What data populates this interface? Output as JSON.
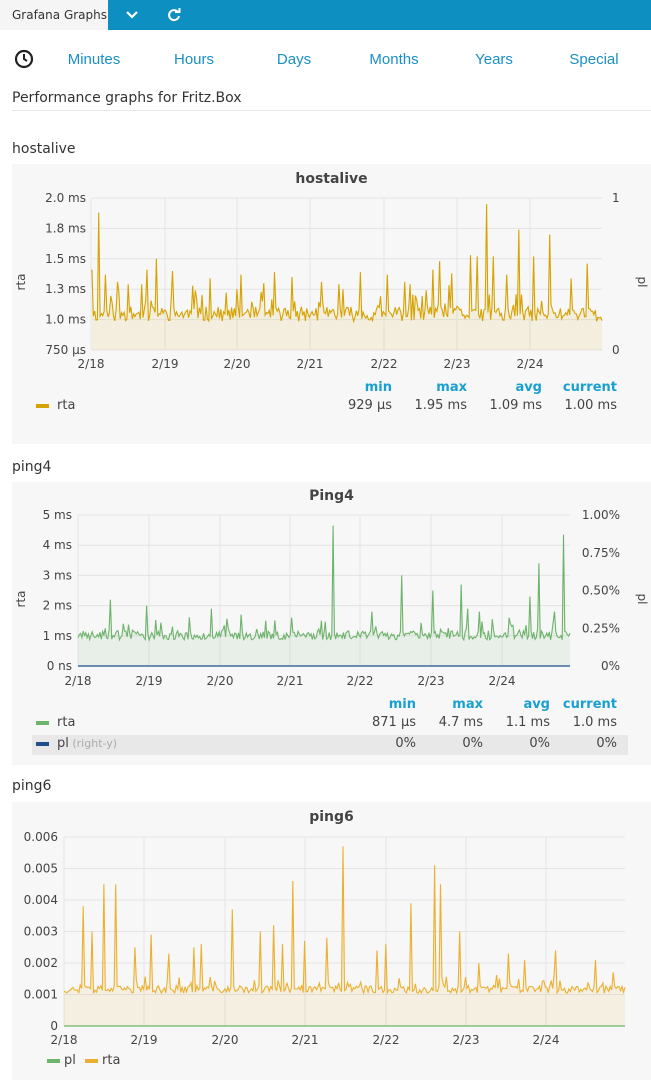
{
  "app": {
    "brand": "Grafana Graphs"
  },
  "tabs": [
    "Minutes",
    "Hours",
    "Days",
    "Months",
    "Years",
    "Special"
  ],
  "page": {
    "title": "Performance graphs for Fritz.Box"
  },
  "sections": [
    {
      "name": "hostalive",
      "panel_title": "hostalive"
    },
    {
      "name": "ping4",
      "panel_title": "Ping4"
    },
    {
      "name": "ping6",
      "panel_title": "ping6"
    }
  ],
  "legend_headers": {
    "min": "min",
    "max": "max",
    "avg": "avg",
    "current": "current"
  },
  "legends": {
    "hostalive": [
      {
        "name": "rta",
        "color": "#d6a200",
        "min": "929 µs",
        "max": "1.95 ms",
        "avg": "1.09 ms",
        "current": "1.00 ms"
      }
    ],
    "ping4": [
      {
        "name": "rta",
        "color": "#6db36a",
        "min": "871 µs",
        "max": "4.7 ms",
        "avg": "1.1 ms",
        "current": "1.0 ms"
      },
      {
        "name": "pl",
        "suffix": "(right-y)",
        "color": "#1f4e8c",
        "min": "0%",
        "max": "0%",
        "avg": "0%",
        "current": "0%"
      }
    ],
    "ping6": [
      {
        "name": "pl",
        "color": "#6db36a"
      },
      {
        "name": "rta",
        "color": "#ebb02f"
      }
    ]
  },
  "chart_data": [
    {
      "type": "line",
      "title": "hostalive",
      "ylabel": "rta",
      "ylabel_right": "pl",
      "x_ticks": [
        "2/18",
        "2/19",
        "2/20",
        "2/21",
        "2/22",
        "2/23",
        "2/24"
      ],
      "y_ticks": [
        "750 µs",
        "1.0 ms",
        "1.3 ms",
        "1.5 ms",
        "1.8 ms",
        "2.0 ms"
      ],
      "y_ticks_right": [
        "0",
        "1"
      ],
      "ylim": [
        0.75,
        2.0
      ],
      "series": [
        {
          "name": "rta",
          "color": "#d6a200",
          "baseline": 1.04,
          "noise": 0.06,
          "seed": 11,
          "spikes": [
            [
              0.0,
              1.41
            ],
            [
              0.1,
              1.88
            ],
            [
              0.19,
              1.37
            ],
            [
              0.35,
              1.31
            ],
            [
              0.5,
              1.29
            ],
            [
              0.68,
              1.29
            ],
            [
              0.76,
              1.41
            ],
            [
              0.88,
              1.5
            ],
            [
              1.1,
              1.4
            ],
            [
              1.38,
              1.28
            ],
            [
              1.63,
              1.34
            ],
            [
              2.05,
              1.37
            ],
            [
              2.36,
              1.3
            ],
            [
              2.51,
              1.39
            ],
            [
              2.75,
              1.35
            ],
            [
              3.15,
              1.31
            ],
            [
              3.39,
              1.29
            ],
            [
              3.69,
              1.39
            ],
            [
              4.06,
              1.37
            ],
            [
              4.3,
              1.31
            ],
            [
              4.68,
              1.41
            ],
            [
              4.78,
              1.48
            ],
            [
              4.93,
              1.38
            ],
            [
              5.2,
              1.53
            ],
            [
              5.29,
              1.52
            ],
            [
              5.42,
              1.95
            ],
            [
              5.51,
              1.52
            ],
            [
              5.7,
              1.37
            ],
            [
              5.86,
              1.74
            ],
            [
              6.06,
              1.52
            ],
            [
              6.28,
              1.7
            ],
            [
              6.57,
              1.34
            ],
            [
              6.79,
              1.46
            ],
            [
              7.01,
              1.42
            ],
            [
              7.19,
              1.29
            ]
          ]
        }
      ]
    },
    {
      "type": "line",
      "title": "Ping4",
      "ylabel": "rta",
      "ylabel_right": "pl",
      "x_ticks": [
        "2/18",
        "2/19",
        "2/20",
        "2/21",
        "2/22",
        "2/23",
        "2/24"
      ],
      "y_ticks": [
        "0 ns",
        "1 ms",
        "2 ms",
        "3 ms",
        "4 ms",
        "5 ms"
      ],
      "y_ticks_right": [
        "0%",
        "0.25%",
        "0.50%",
        "0.75%",
        "1.00%"
      ],
      "ylim": [
        0,
        5
      ],
      "series": [
        {
          "name": "rta",
          "color": "#6db36a",
          "baseline": 1.0,
          "noise": 0.15,
          "seed": 23,
          "spikes": [
            [
              0.46,
              2.2
            ],
            [
              0.97,
              2.0
            ],
            [
              1.9,
              1.9
            ],
            [
              2.32,
              1.7
            ],
            [
              2.67,
              1.5
            ],
            [
              3.04,
              1.6
            ],
            [
              3.47,
              1.5
            ],
            [
              3.63,
              4.65
            ],
            [
              4.18,
              1.8
            ],
            [
              4.6,
              3.0
            ],
            [
              5.04,
              2.5
            ],
            [
              5.45,
              2.7
            ],
            [
              5.55,
              1.9
            ],
            [
              5.71,
              1.8
            ],
            [
              6.14,
              1.6
            ],
            [
              6.43,
              2.3
            ],
            [
              6.55,
              3.4
            ],
            [
              6.78,
              1.8
            ],
            [
              6.9,
              4.35
            ]
          ]
        },
        {
          "name": "pl",
          "color": "#1f4e8c",
          "constant": 0
        }
      ]
    },
    {
      "type": "line",
      "title": "ping6",
      "x_ticks": [
        "2/18",
        "2/19",
        "2/20",
        "2/21",
        "2/22",
        "2/23",
        "2/24"
      ],
      "y_ticks": [
        "0",
        "0.001",
        "0.002",
        "0.003",
        "0.004",
        "0.005",
        "0.006"
      ],
      "ylim": [
        0,
        0.006
      ],
      "series": [
        {
          "name": "rta",
          "color": "#ebb02f",
          "baseline": 0.00115,
          "noise": 0.00012,
          "seed": 37,
          "spikes": [
            [
              0.24,
              0.0038
            ],
            [
              0.5,
              0.0045
            ],
            [
              0.64,
              0.0045
            ],
            [
              0.35,
              0.003
            ],
            [
              0.88,
              0.0025
            ],
            [
              1.08,
              0.0029
            ],
            [
              1.3,
              0.0023
            ],
            [
              1.63,
              0.0025
            ],
            [
              1.72,
              0.0026
            ],
            [
              2.1,
              0.0037
            ],
            [
              2.45,
              0.003
            ],
            [
              2.62,
              0.0032
            ],
            [
              2.72,
              0.0026
            ],
            [
              2.85,
              0.0046
            ],
            [
              3.01,
              0.0027
            ],
            [
              3.28,
              0.0028
            ],
            [
              3.49,
              0.0057
            ],
            [
              3.9,
              0.0024
            ],
            [
              4.02,
              0.0026
            ],
            [
              4.33,
              0.0039
            ],
            [
              4.63,
              0.0051
            ],
            [
              4.7,
              0.0045
            ],
            [
              4.94,
              0.003
            ],
            [
              5.18,
              0.002
            ],
            [
              5.55,
              0.0023
            ],
            [
              5.74,
              0.0021
            ],
            [
              6.14,
              0.0024
            ],
            [
              6.63,
              0.0021
            ],
            [
              6.85,
              0.0017
            ]
          ]
        },
        {
          "name": "pl",
          "color": "#6db36a",
          "constant": 0
        }
      ]
    }
  ]
}
